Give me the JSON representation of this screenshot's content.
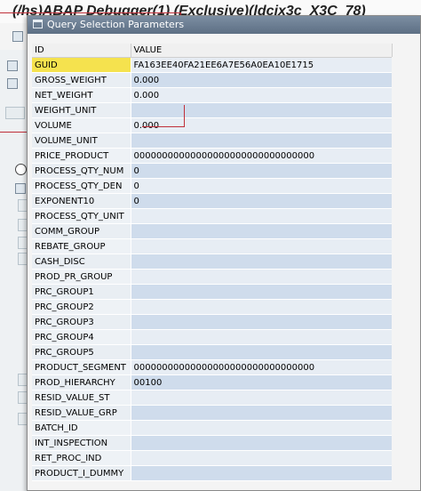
{
  "background_window": {
    "title": "(/hs)ABAP Debugger(1)  (Exclusive)(ldcix3c_X3C_78)"
  },
  "popup": {
    "title": "Query Selection Parameters",
    "columns": {
      "id": "ID",
      "value": "VALUE"
    },
    "rows": [
      {
        "id": "GUID",
        "value": "FA163EE40FA21EE6A7E56A0EA10E1715"
      },
      {
        "id": "GROSS_WEIGHT",
        "value": "0.000"
      },
      {
        "id": "NET_WEIGHT",
        "value": "0.000"
      },
      {
        "id": "WEIGHT_UNIT",
        "value": ""
      },
      {
        "id": "VOLUME",
        "value": "0.000"
      },
      {
        "id": "VOLUME_UNIT",
        "value": ""
      },
      {
        "id": "PRICE_PRODUCT",
        "value": "00000000000000000000000000000000"
      },
      {
        "id": "PROCESS_QTY_NUM",
        "value": "0"
      },
      {
        "id": "PROCESS_QTY_DEN",
        "value": "0"
      },
      {
        "id": "EXPONENT10",
        "value": "0"
      },
      {
        "id": "PROCESS_QTY_UNIT",
        "value": ""
      },
      {
        "id": "COMM_GROUP",
        "value": ""
      },
      {
        "id": "REBATE_GROUP",
        "value": ""
      },
      {
        "id": "CASH_DISC",
        "value": ""
      },
      {
        "id": "PROD_PR_GROUP",
        "value": ""
      },
      {
        "id": "PRC_GROUP1",
        "value": ""
      },
      {
        "id": "PRC_GROUP2",
        "value": ""
      },
      {
        "id": "PRC_GROUP3",
        "value": ""
      },
      {
        "id": "PRC_GROUP4",
        "value": ""
      },
      {
        "id": "PRC_GROUP5",
        "value": ""
      },
      {
        "id": "PRODUCT_SEGMENT",
        "value": "00000000000000000000000000000000"
      },
      {
        "id": "PROD_HIERARCHY",
        "value": "00100"
      },
      {
        "id": "RESID_VALUE_ST",
        "value": ""
      },
      {
        "id": "RESID_VALUE_GRP",
        "value": ""
      },
      {
        "id": "BATCH_ID",
        "value": ""
      },
      {
        "id": "INT_INSPECTION",
        "value": ""
      },
      {
        "id": "RET_PROC_IND",
        "value": ""
      },
      {
        "id": "PRODUCT_I_DUMMY",
        "value": ""
      }
    ]
  },
  "colors": {
    "selected_key": "#f5e24e",
    "row_band_light": "#e7edf4",
    "row_band_dark": "#cfdcec",
    "title_bar": "#6b7d92",
    "annotation_line": "#c0303a"
  }
}
